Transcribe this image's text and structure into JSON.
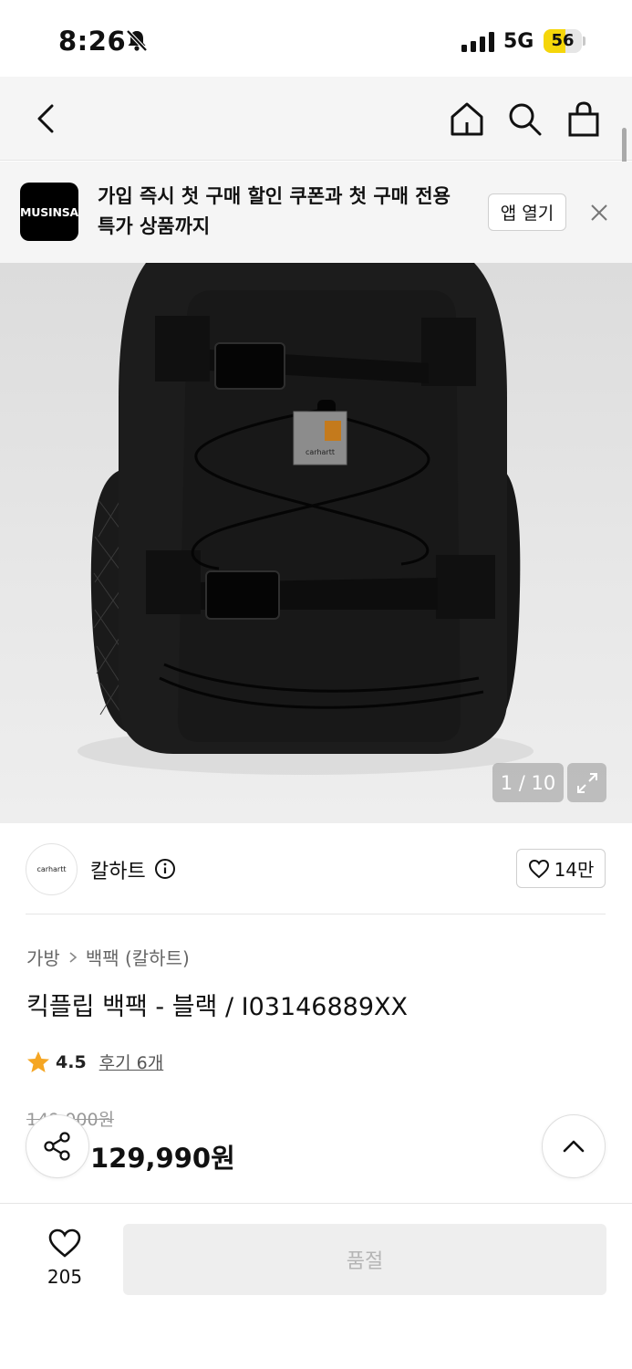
{
  "status_bar": {
    "time": "8:26",
    "network": "5G",
    "battery_level": 56,
    "battery_label": "56"
  },
  "nav": {
    "icons": [
      "back-icon",
      "home-icon",
      "search-icon",
      "shopping-bag-icon"
    ]
  },
  "banner": {
    "logo_text": "MUSINSA",
    "message": "가입 즉시 첫 구매 할인 쿠폰과 첫 구매 전용 특가 상품까지",
    "open_app_label": "앱 열기"
  },
  "gallery": {
    "counter": "1 / 10",
    "tag_text": "carhartt"
  },
  "brand": {
    "logo_text": "carhartt",
    "name": "칼하트",
    "like_count": "14만"
  },
  "product": {
    "breadcrumb": [
      "가방",
      "백팩 (칼하트)"
    ],
    "title": "킥플립 백팩 - 블랙 / I03146889XX",
    "rating": "4.5",
    "review_label": "후기 6개",
    "original_price": "149,000원",
    "sale_price": "129,990원"
  },
  "bottom_bar": {
    "like_count": "205",
    "buy_label": "품절"
  },
  "colors": {
    "battery_yellow": "#f5d60a",
    "star": "#f5a623",
    "soldout_bg": "#eeeeee"
  }
}
